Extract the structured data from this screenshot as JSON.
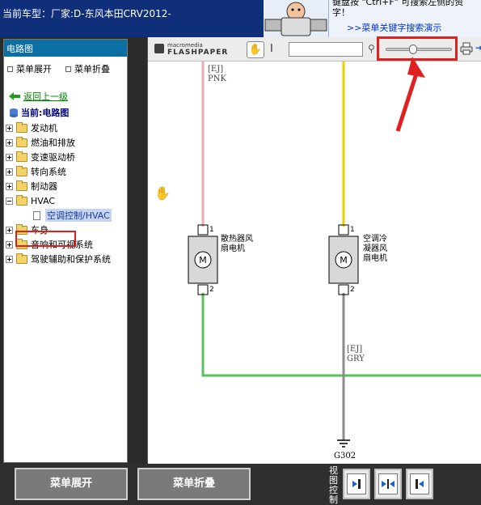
{
  "header": {
    "car_model": "当前车型：厂家:D-东风本田CRV2012-",
    "hint_line": "键盘按 \"Ctrl+F\" 可搜索左侧的资\n字！",
    "hint_link": ">>菜单关键字搜索演示"
  },
  "left_panel": {
    "title": "电路图",
    "expand_label": "菜单展开",
    "collapse_label": "菜单折叠",
    "back_label": "返回上一级",
    "current_label": "当前:电路图",
    "tree": [
      {
        "label": "发动机",
        "expanded": false
      },
      {
        "label": "燃油和排放",
        "expanded": false
      },
      {
        "label": "变速驱动桥",
        "expanded": false
      },
      {
        "label": "转向系统",
        "expanded": false
      },
      {
        "label": "制动器",
        "expanded": false
      },
      {
        "label": "HVAC",
        "expanded": true
      },
      {
        "label": "车身",
        "expanded": false
      },
      {
        "label": "音响和可视系统",
        "expanded": false
      },
      {
        "label": "驾驶辅助和保护系统",
        "expanded": false
      }
    ],
    "selected_leaf": "空调控制/HVAC"
  },
  "viewer": {
    "logo_small": "macromedia",
    "logo_big": "FLASHPAPER",
    "search_value": "",
    "zoom_fraction": 0.4,
    "schematic": {
      "wire1_top_label": "[EJ]",
      "wire1_color_label": "PNK",
      "motor1_label": "散热器风扇电机",
      "motor2_label": "空调冷凝器风扇电机",
      "pin_top": "1",
      "pin_bottom": "2",
      "wire2_top_label": "[EJ]",
      "wire2_color_label": "GRY",
      "ground_label": "G302"
    }
  },
  "bottom": {
    "expand_button": "菜单展开",
    "collapse_button": "菜单折叠",
    "view_control_label": "视图控制"
  },
  "colors": {
    "header_bg": "#0f2f7a",
    "panel_title_bg": "#0b6fa4",
    "highlight_red": "#e0201e",
    "wire_pink": "#f3a6b3",
    "wire_yellow": "#e6d100",
    "wire_green": "#5bc05b",
    "wire_gray": "#8c8c8c"
  }
}
